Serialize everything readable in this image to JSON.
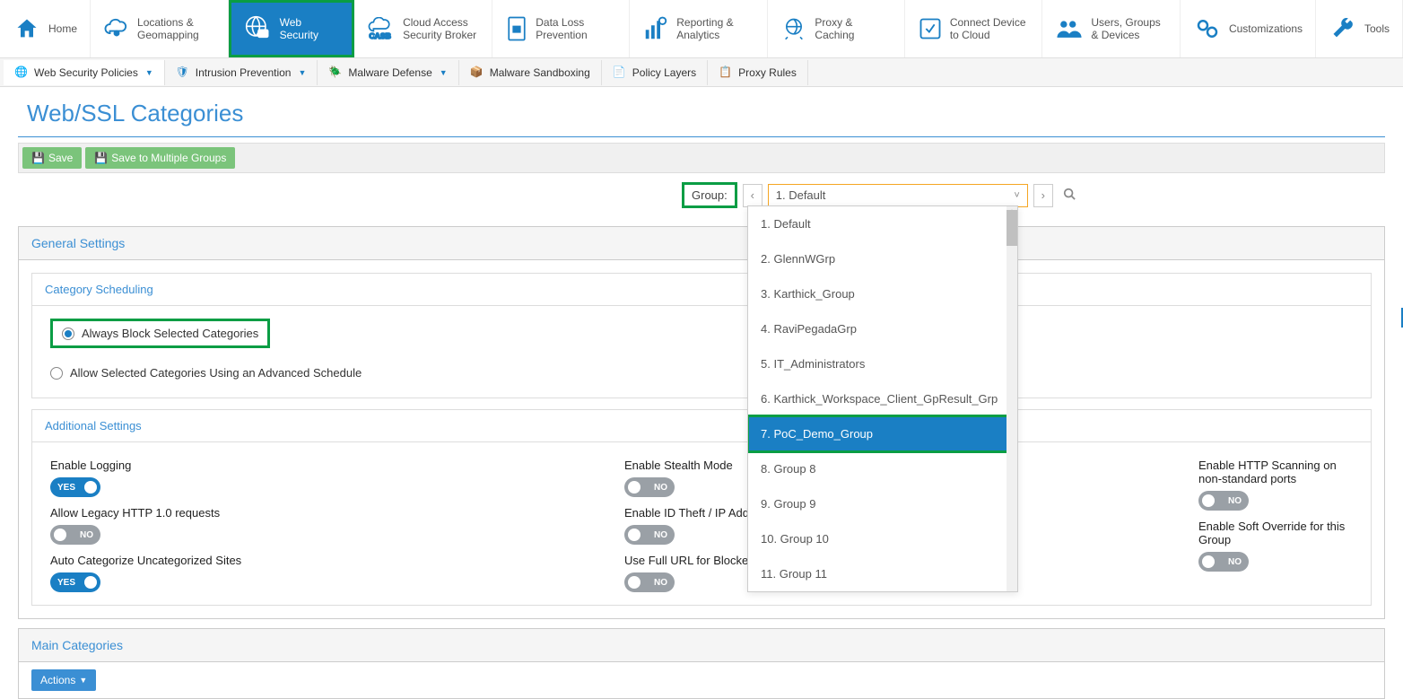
{
  "topnav": {
    "home": "Home",
    "locations": "Locations & Geomapping",
    "websecurity": "Web Security",
    "casb": "Cloud Access Security Broker",
    "dlp": "Data Loss Prevention",
    "reporting": "Reporting & Analytics",
    "proxy": "Proxy & Caching",
    "connect": "Connect Device to Cloud",
    "users": "Users, Groups & Devices",
    "custom": "Customizations",
    "tools": "Tools"
  },
  "subnav": {
    "policies": "Web Security Policies",
    "intrusion": "Intrusion Prevention",
    "malware": "Malware Defense",
    "sandbox": "Malware Sandboxing",
    "layers": "Policy Layers",
    "proxyrules": "Proxy Rules"
  },
  "page": {
    "title": "Web/SSL Categories"
  },
  "savebar": {
    "save": "Save",
    "save_multi": "Save to Multiple Groups"
  },
  "group": {
    "label": "Group:",
    "selected": "1. Default",
    "options": [
      "1. Default",
      "2. GlennWGrp",
      "3. Karthick_Group",
      "4. RaviPegadaGrp",
      "5. IT_Administrators",
      "6. Karthick_Workspace_Client_GpResult_Grp",
      "7. PoC_Demo_Group",
      "8. Group 8",
      "9. Group 9",
      "10. Group 10",
      "11. Group 11"
    ],
    "highlighted_index": 6
  },
  "panels": {
    "general": "General Settings",
    "category_sched": "Category Scheduling",
    "radio_always": "Always Block Selected Categories",
    "radio_allow": "Allow Selected Categories Using an Advanced Schedule",
    "additional": "Additional Settings",
    "main_categories": "Main Categories",
    "actions": "Actions"
  },
  "settings": {
    "col1": [
      {
        "label": "Enable Logging",
        "value": "YES",
        "on": true
      },
      {
        "label": "Allow Legacy HTTP 1.0 requests",
        "value": "NO",
        "on": false
      },
      {
        "label": "Auto Categorize Uncategorized Sites",
        "value": "YES",
        "on": true
      }
    ],
    "col2": [
      {
        "label": "Enable Stealth Mode",
        "value": "NO",
        "on": false
      },
      {
        "label": "Enable ID Theft / IP Address",
        "value": "NO",
        "on": false
      },
      {
        "label": "Use Full URL for Blocked Sit",
        "value": "NO",
        "on": false
      }
    ],
    "col3": [
      {
        "label": "Enable HTTP Scanning on non-standard ports",
        "value": "NO",
        "on": false
      },
      {
        "label": "Enable Soft Override for this Group",
        "value": "NO",
        "on": false
      }
    ]
  }
}
